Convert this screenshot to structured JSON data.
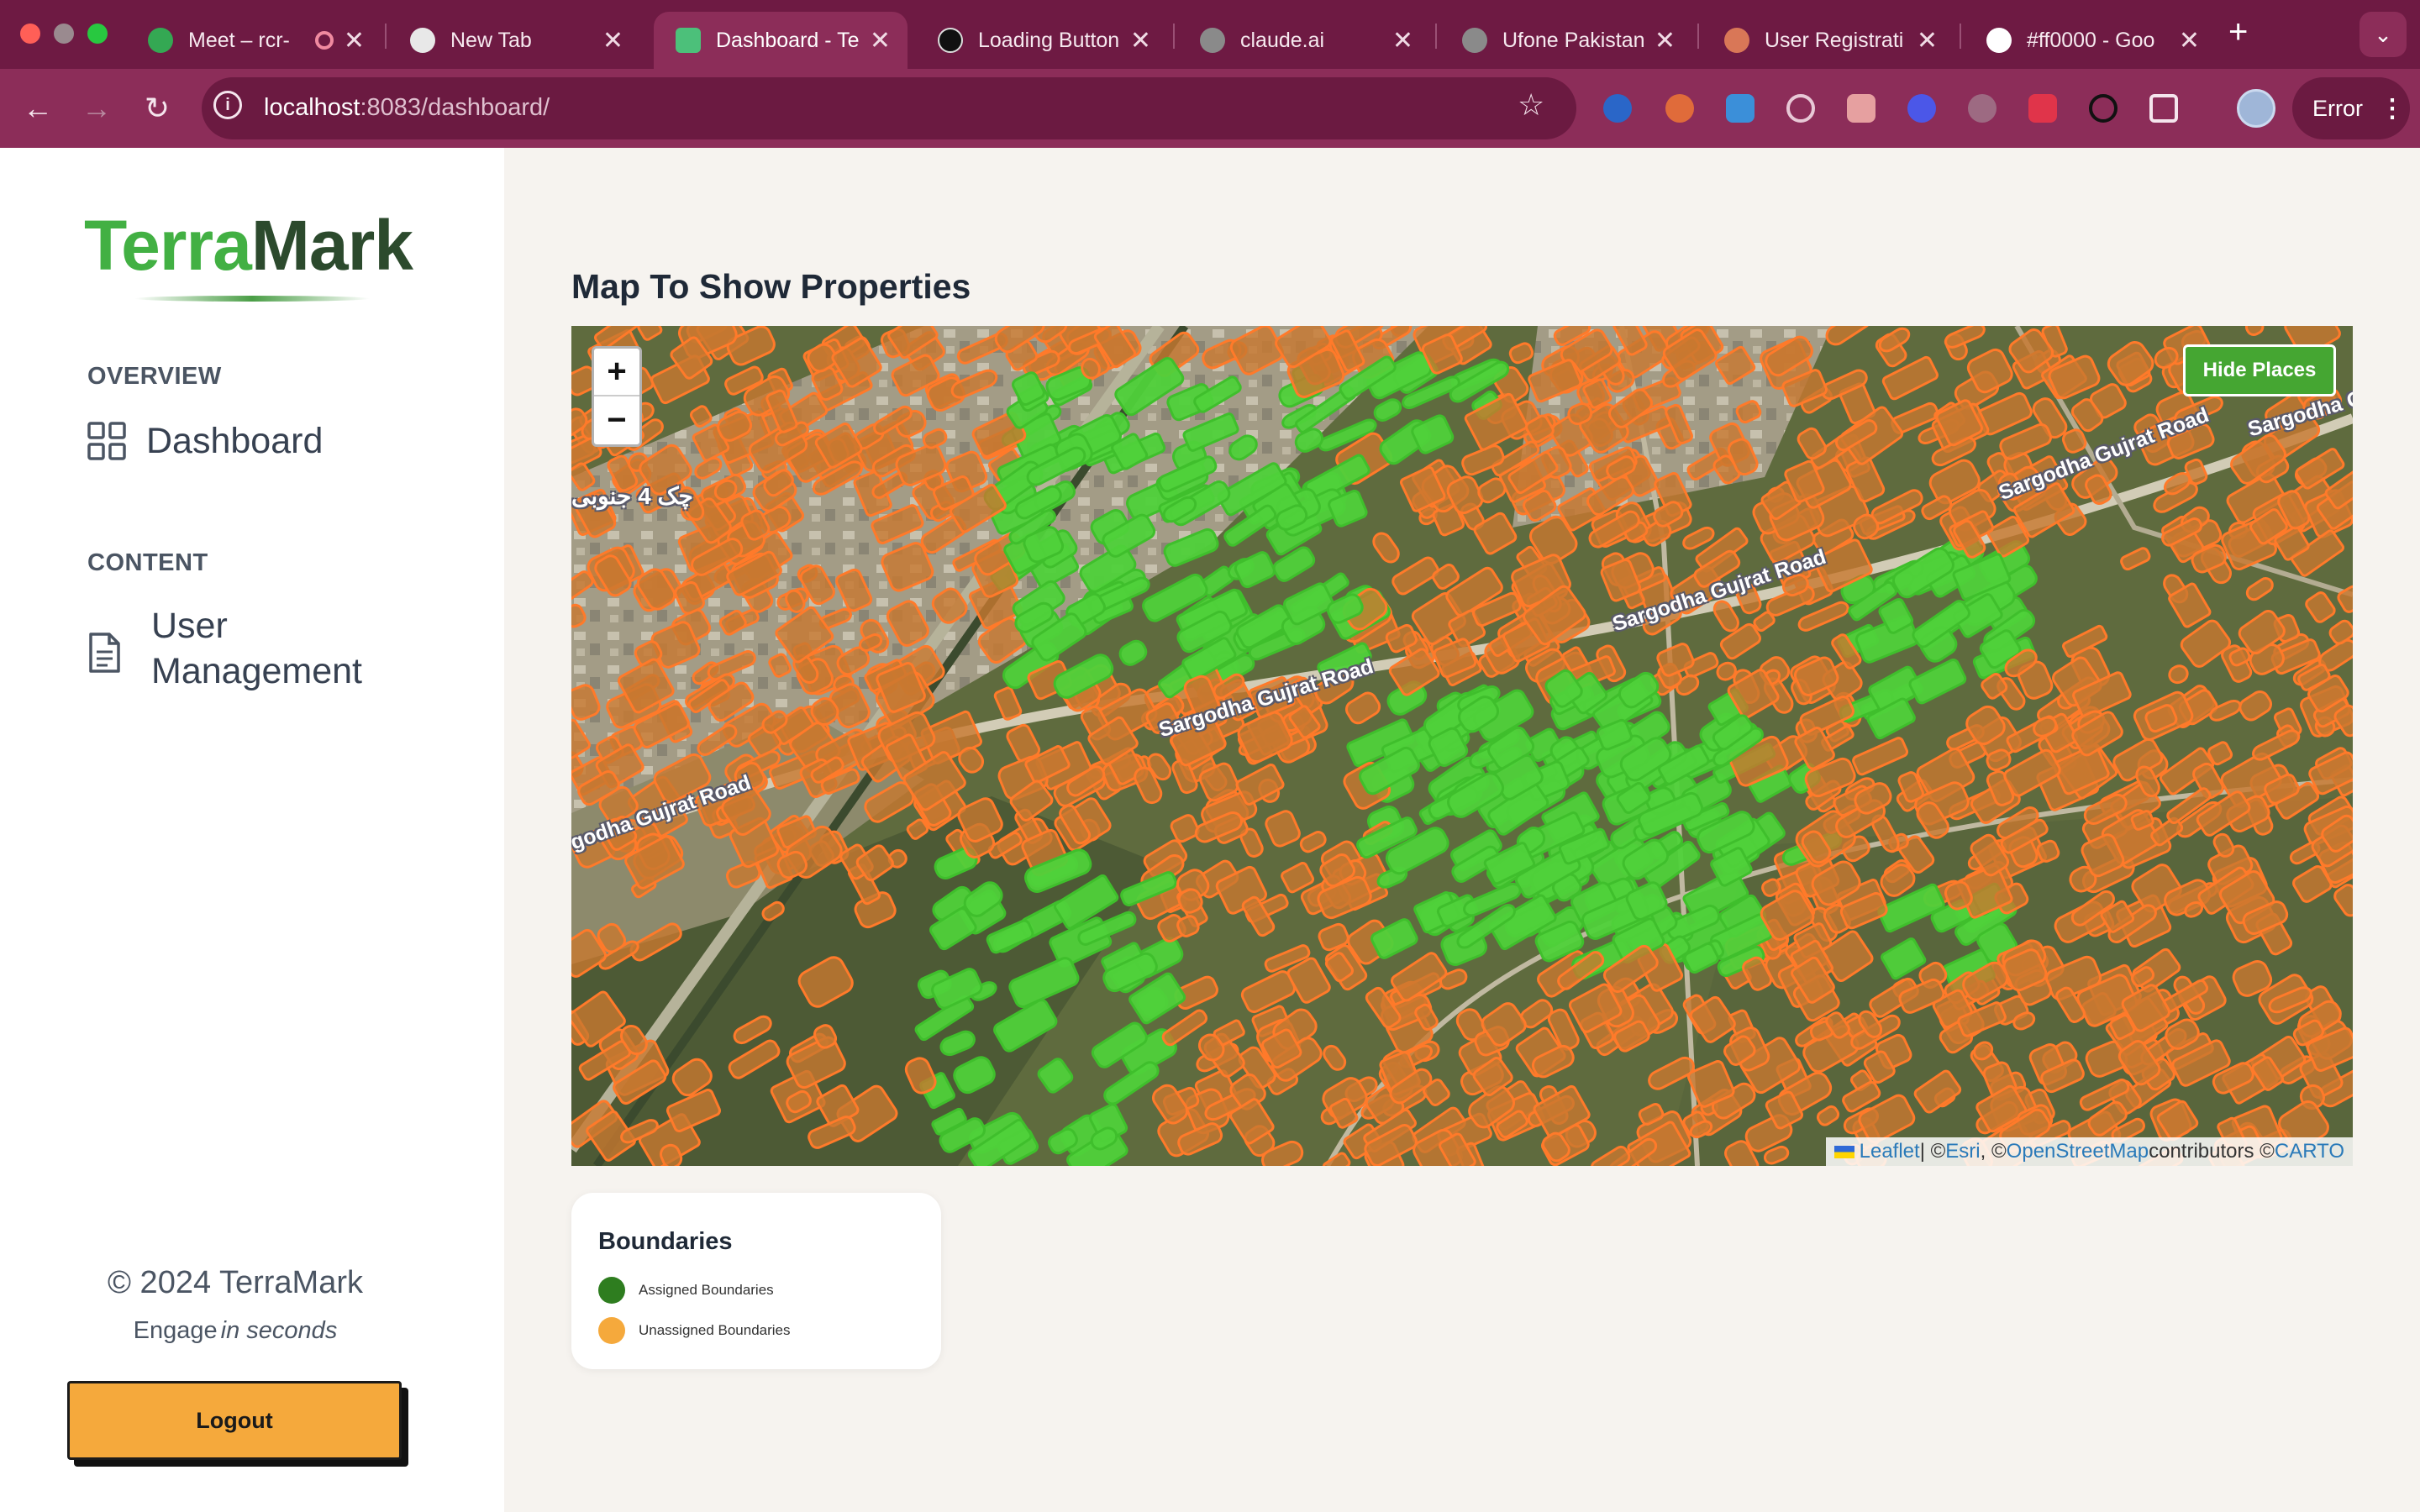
{
  "browser": {
    "tabs": [
      {
        "title": "Meet – rcr-",
        "favicon_color": "#34a853"
      },
      {
        "title": "New Tab",
        "favicon_color": "#e8e8e8"
      },
      {
        "title": "Dashboard - Te",
        "favicon_color": "#4cc07a"
      },
      {
        "title": "Loading Button",
        "favicon_color": "#111111"
      },
      {
        "title": "claude.ai",
        "favicon_color": "#8a8a8a"
      },
      {
        "title": "Ufone Pakistan",
        "favicon_color": "#8a8a8a"
      },
      {
        "title": "User Registrati",
        "favicon_color": "#d97757"
      },
      {
        "title": "#ff0000 - Goo",
        "favicon_color": "#ffffff"
      }
    ],
    "url_host": "localhost",
    "url_path": ":8083/dashboard/",
    "profile_status": "Error"
  },
  "sidebar": {
    "logo_part1": "Terra",
    "logo_part2": "Mark",
    "section_overview": "OVERVIEW",
    "dashboard_label": "Dashboard",
    "section_content": "CONTENT",
    "user_mgmt_line1": "User",
    "user_mgmt_line2": "Management",
    "copyright": "© 2024 TerraMark",
    "tagline_main": "Engage",
    "tagline_em": "in seconds",
    "logout_label": "Logout"
  },
  "main": {
    "map_title": "Map To Show Properties",
    "zoom_in": "+",
    "zoom_out": "−",
    "hide_places": "Hide Places",
    "road_labels": [
      "Sargodha Gujrat Road",
      "Sargodha Gujrat Road",
      "Sargodha Gujrat Road",
      "Sargodha Gujrat Road",
      "Sargodha G",
      "godha Gujrat Road"
    ],
    "place_label": "چک 4 جنوبی",
    "attribution": {
      "leaflet": "Leaflet",
      "sep1": " | © ",
      "esri": "Esri",
      "sep2": ", © ",
      "osm": "OpenStreetMap",
      "sep3": " contributors © ",
      "carto": "CARTO"
    }
  },
  "legend": {
    "title": "Boundaries",
    "items": [
      {
        "label": "Assigned Boundaries",
        "color": "#2e7d1f"
      },
      {
        "label": "Unassigned Boundaries",
        "color": "#f5a93c"
      }
    ]
  },
  "colors": {
    "tabbar": "#6e1a43",
    "toolbar": "#8c2d59",
    "assigned_fill": "#4fd13a",
    "unassigned_fill": "#c8782f",
    "unassigned_stroke": "#ff7a2a"
  }
}
